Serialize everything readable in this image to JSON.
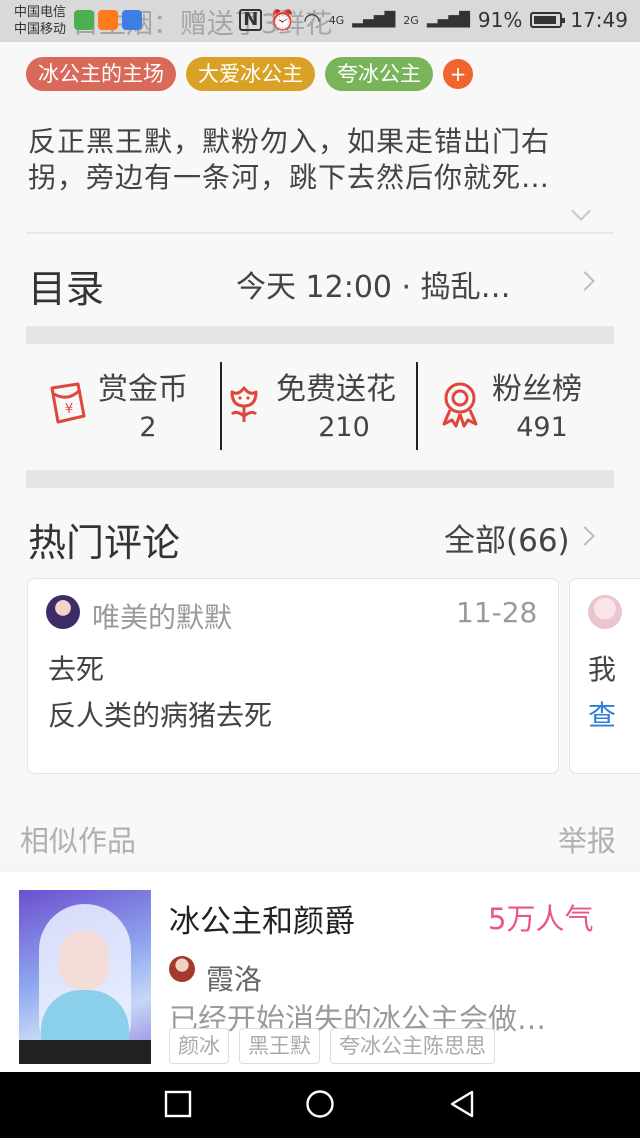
{
  "status_bar": {
    "carrier_1": "中国电信",
    "carrier_2": "中国移动",
    "ghost_text": "日主烟：赠送了3鲜花",
    "network_1": "4G",
    "network_2": "2G",
    "battery": "91%",
    "time": "17:49"
  },
  "tags": {
    "items": [
      "冰公主的主场",
      "大爱冰公主",
      "夸冰公主"
    ],
    "colors": [
      "#d96a5a",
      "#d9a126",
      "#79b45a"
    ],
    "add": "+"
  },
  "intro": {
    "line1": "反正黑王默，默粉勿入，如果走错出门右",
    "line2": "拐，旁边有一条河，跳下去然后你就死…"
  },
  "catalog": {
    "title": "目录",
    "update": "今天 12:00 · 捣乱…"
  },
  "stats": {
    "reward_label": "赏金币",
    "reward_value": "2",
    "flower_label": "免费送花",
    "flower_value": "210",
    "fans_label": "粉丝榜",
    "fans_value": "491"
  },
  "comments": {
    "title": "热门评论",
    "all": "全部(66)",
    "card1": {
      "user": "唯美的默默",
      "date": "11-28",
      "line1": "去死",
      "line2": "反人类的病猪去死"
    },
    "card2": {
      "line1": "我",
      "line2": "查"
    }
  },
  "similar": {
    "title": "相似作品",
    "report": "举报",
    "work": {
      "title": "冰公主和颜爵",
      "popularity": "5万人气",
      "author": "霞洛",
      "desc": "已经开始消失的冰公主会做…",
      "tags": [
        "颜冰",
        "黑王默",
        "夸冰公主陈思思"
      ]
    }
  },
  "nav": {
    "icons": [
      "square-recent-icon",
      "circle-home-icon",
      "triangle-back-icon"
    ]
  }
}
